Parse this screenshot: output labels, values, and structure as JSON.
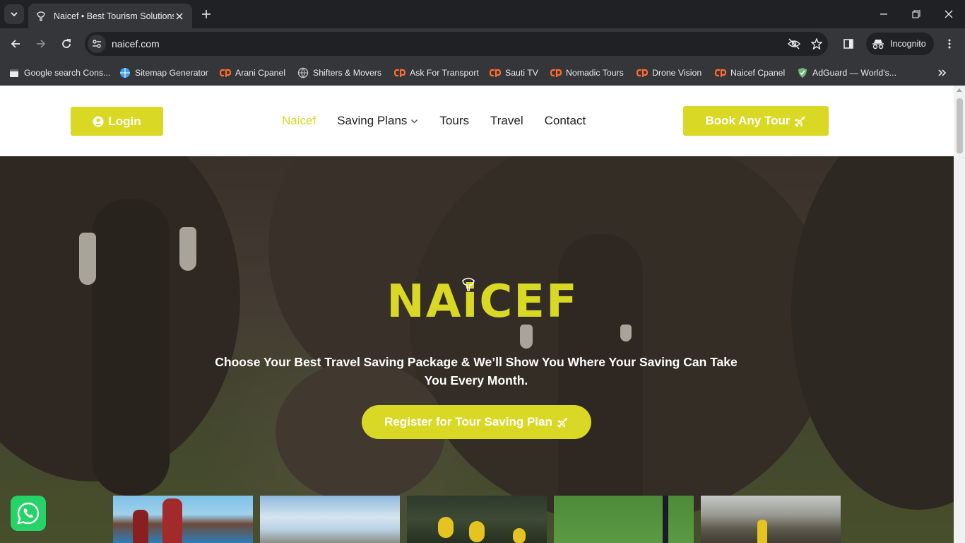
{
  "browser": {
    "tab_title": "Naicef • Best Tourism Solutions",
    "url": "naicef.com",
    "profile_label": "Incognito",
    "bookmarks": [
      {
        "label": "Google search Cons...",
        "icon": "calendar-icon"
      },
      {
        "label": "Sitemap Generator",
        "icon": "globe-blue-icon"
      },
      {
        "label": "Arani Cpanel",
        "icon": "cpanel-icon"
      },
      {
        "label": "Shifters & Movers",
        "icon": "globe-icon"
      },
      {
        "label": "Ask For Transport",
        "icon": "cpanel-icon"
      },
      {
        "label": "Sauti TV",
        "icon": "cpanel-icon"
      },
      {
        "label": "Nomadic Tours",
        "icon": "cpanel-icon"
      },
      {
        "label": "Drone Vision",
        "icon": "cpanel-icon"
      },
      {
        "label": "Naicef Cpanel",
        "icon": "cpanel-icon"
      },
      {
        "label": "AdGuard — World's...",
        "icon": "shield-icon"
      }
    ]
  },
  "site": {
    "login_label": "Login",
    "nav": {
      "home": "Naicef",
      "saving_plans": "Saving Plans",
      "tours": "Tours",
      "travel": "Travel",
      "contact": "Contact"
    },
    "book_label": "Book Any Tour",
    "logo_text": "NAiCEF",
    "tagline": "Choose Your Best Travel Saving Package & We’ll Show You Where Your Saving Can Take You Every Month.",
    "register_label": "Register for Tour Saving Plan",
    "accent_color": "#d9d824"
  }
}
